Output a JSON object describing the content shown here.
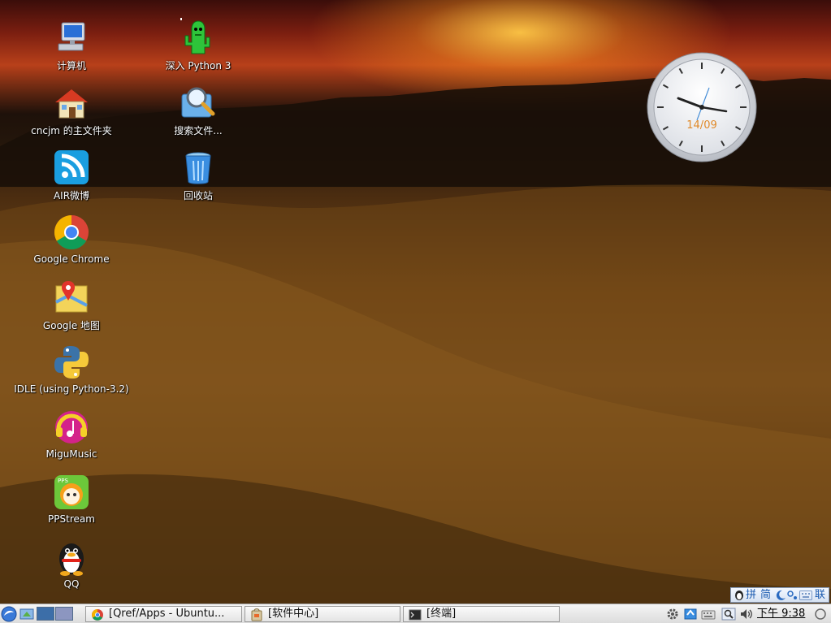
{
  "desktop": {
    "icons": [
      {
        "label": "计算机",
        "icon": "computer-icon"
      },
      {
        "label": "cncjm 的主文件夹",
        "icon": "home-folder-icon"
      },
      {
        "label": "AIR微博",
        "icon": "air-weibo-icon"
      },
      {
        "label": "Google Chrome",
        "icon": "chrome-icon"
      },
      {
        "label": "Google 地图",
        "icon": "google-maps-icon"
      },
      {
        "label": "IDLE (using Python-3.2)",
        "icon": "python-idle-icon"
      },
      {
        "label": "MiguMusic",
        "icon": "migu-music-icon"
      },
      {
        "label": "PPStream",
        "icon": "ppstream-icon"
      },
      {
        "label": "QQ",
        "icon": "qq-penguin-icon"
      },
      {
        "label": "深入 Python 3",
        "icon": "dive-into-python-icon"
      },
      {
        "label": "搜索文件...",
        "icon": "search-files-icon"
      },
      {
        "label": "回收站",
        "icon": "trash-icon"
      }
    ]
  },
  "clock_widget": {
    "date": "14/09"
  },
  "ime_bar": {
    "items": [
      "拼",
      "简",
      "联"
    ]
  },
  "taskbar": {
    "tasks": [
      {
        "label": "[Qref/Apps - Ubuntu...",
        "icon": "chrome-icon"
      },
      {
        "label": "[软件中心]",
        "icon": "software-center-icon"
      },
      {
        "label": "[终端]",
        "icon": "terminal-icon"
      }
    ],
    "clock": "下午 9:38",
    "colors": {
      "workspace_active": "#3c6ea8",
      "workspace_inactive": "#8c96c0"
    }
  }
}
